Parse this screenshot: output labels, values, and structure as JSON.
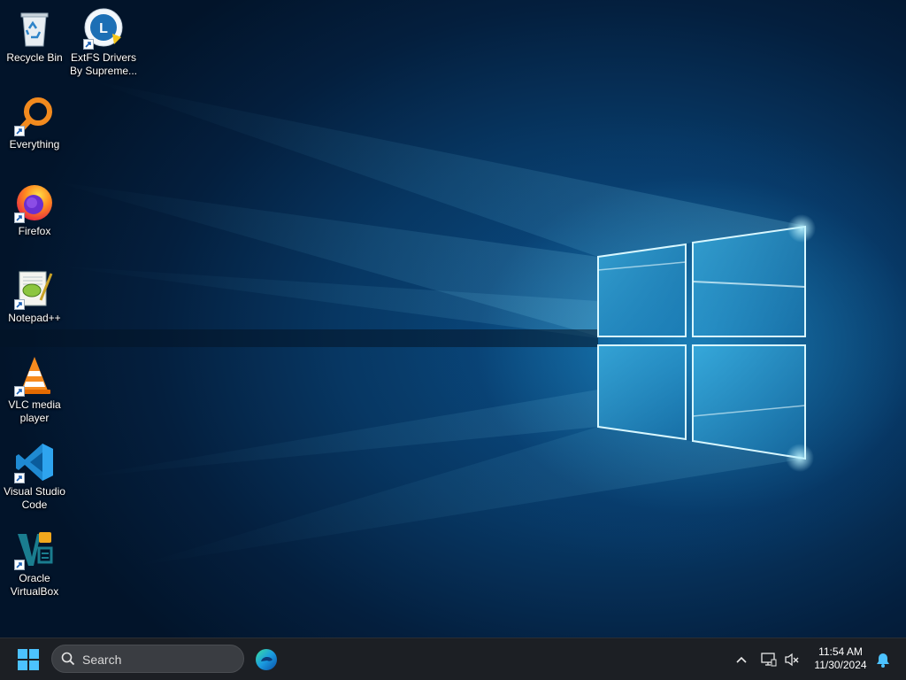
{
  "desktop": {
    "icons": [
      {
        "label": "Recycle Bin",
        "icon": "recycle-bin-icon"
      },
      {
        "label": "ExtFS Drivers\nBy Supreme...",
        "icon": "extfs-icon"
      },
      {
        "label": "Everything",
        "icon": "everything-search-icon"
      },
      {
        "label": "Firefox",
        "icon": "firefox-icon"
      },
      {
        "label": "Notepad++",
        "icon": "notepad-plus-plus-icon"
      },
      {
        "label": "VLC media\nplayer",
        "icon": "vlc-icon"
      },
      {
        "label": "Visual Studio\nCode",
        "icon": "vscode-icon"
      },
      {
        "label": "Oracle\nVirtualBox",
        "icon": "virtualbox-icon"
      }
    ]
  },
  "taskbar": {
    "search_placeholder": "Search",
    "clock": {
      "time": "11:54 AM",
      "date": "11/30/2024"
    }
  },
  "colors": {
    "taskbar_bg": "#1c1f24",
    "accent": "#0078d4"
  }
}
